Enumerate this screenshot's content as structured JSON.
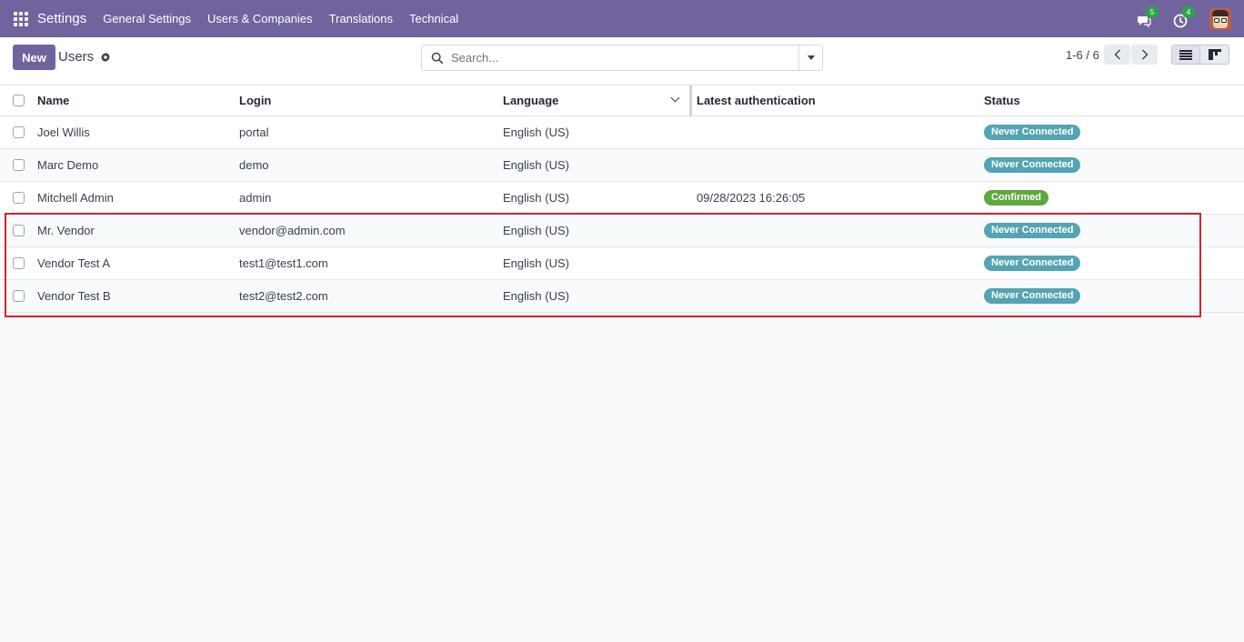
{
  "navbar": {
    "app_title": "Settings",
    "menu": [
      "General Settings",
      "Users & Companies",
      "Translations",
      "Technical"
    ],
    "messages_count": "5",
    "activities_count": "4"
  },
  "control_panel": {
    "new_label": "New",
    "breadcrumb": "Users",
    "search_placeholder": "Search...",
    "pager": "1-6 / 6"
  },
  "table": {
    "columns": [
      "Name",
      "Login",
      "Language",
      "Latest authentication",
      "Status"
    ],
    "rows": [
      {
        "name": "Joel Willis",
        "login": "portal",
        "language": "English (US)",
        "latest_auth": "",
        "status": "Never Connected",
        "status_color": "#54a4b3"
      },
      {
        "name": "Marc Demo",
        "login": "demo",
        "language": "English (US)",
        "latest_auth": "",
        "status": "Never Connected",
        "status_color": "#54a4b3"
      },
      {
        "name": "Mitchell Admin",
        "login": "admin",
        "language": "English (US)",
        "latest_auth": "09/28/2023 16:26:05",
        "status": "Confirmed",
        "status_color": "#5fa83c"
      },
      {
        "name": "Mr. Vendor",
        "login": "vendor@admin.com",
        "language": "English (US)",
        "latest_auth": "",
        "status": "Never Connected",
        "status_color": "#54a4b3"
      },
      {
        "name": "Vendor Test A",
        "login": "test1@test1.com",
        "language": "English (US)",
        "latest_auth": "",
        "status": "Never Connected",
        "status_color": "#54a4b3"
      },
      {
        "name": "Vendor Test B",
        "login": "test2@test2.com",
        "language": "English (US)",
        "latest_auth": "",
        "status": "Never Connected",
        "status_color": "#54a4b3"
      }
    ]
  },
  "colors": {
    "brand": "#71639e",
    "highlight": "#d0242f"
  }
}
